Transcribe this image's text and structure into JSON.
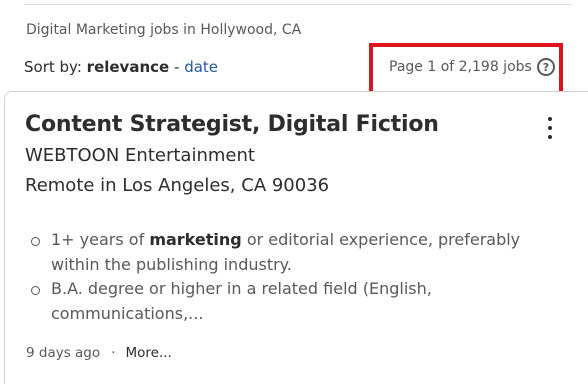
{
  "search": {
    "context": "Digital Marketing jobs in Hollywood, CA"
  },
  "sort": {
    "prefix": "Sort by:",
    "active": "relevance",
    "separator": "-",
    "alternative": "date"
  },
  "pagination": {
    "text": "Page 1 of 2,198 jobs",
    "help_icon_glyph": "?",
    "highlight_color": "#e0141d"
  },
  "job": {
    "title": "Content Strategist, Digital Fiction",
    "company": "WEBTOON Entertainment",
    "location": "Remote in Los Angeles, CA 90036",
    "snippets": [
      {
        "keyword": "1+ years of",
        "bold": "marketing",
        "rest": "or editorial experience, preferably within the publishing industry."
      },
      {
        "text": "B.A. degree or higher in a related field (English, communications,..."
      }
    ],
    "posted": "9 days ago",
    "separator": "·",
    "more_label": "More..."
  },
  "colors": {
    "link": "#2557a7",
    "text_primary": "#2d2d2d",
    "text_secondary": "#595959"
  }
}
